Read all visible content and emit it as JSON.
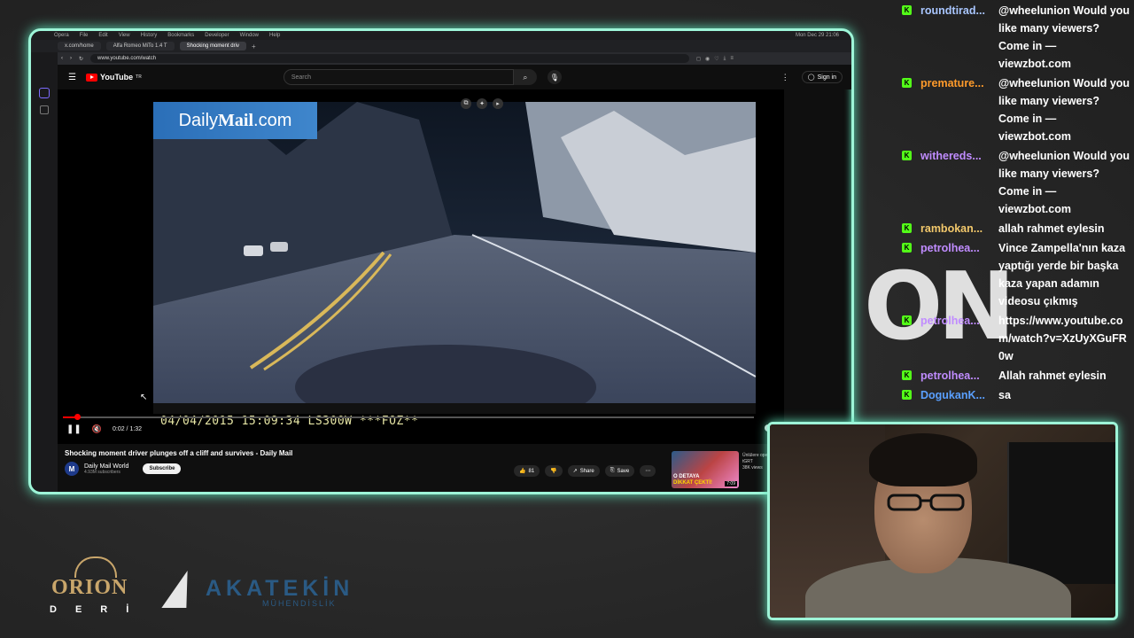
{
  "browser": {
    "mac_menu": [
      "Opera",
      "File",
      "Edit",
      "View",
      "History",
      "Bookmarks",
      "Developer",
      "Window",
      "Help"
    ],
    "clock": "Mon Dec 29  21:06",
    "tabs": [
      {
        "label": "x.com/home"
      },
      {
        "label": "Alfa Romeo MiTo 1.4 T"
      },
      {
        "label": "Shocking moment driv"
      }
    ],
    "url": "www.youtube.com/watch"
  },
  "youtube": {
    "logo_text": "YouTube",
    "logo_sup": "TR",
    "search_placeholder": "Search",
    "signin": "Sign in",
    "watermark_daily": "Daily",
    "watermark_mail": "Mail",
    "watermark_com": ".com",
    "dashcam_overlay": "04/04/2015 15:09:34 LS300W  ***FOZ**",
    "time": "0:02 / 1:32",
    "progress_fraction": 0.02,
    "title": "Shocking moment driver plunges off a cliff and survives - Daily Mail",
    "channel": "Daily Mail World",
    "subscribers": "4.93M subscribers",
    "subscribe": "Subscribe",
    "likes": "81",
    "share": "Share",
    "save": "Save",
    "rec_thumb_line1": "O DETAYA",
    "rec_thumb_line2": "DİKKAT ÇEKTİ!",
    "rec_thumb_time": "7:09",
    "rec_title": "Ünlülere operasyo...",
    "rec_channel": "tGRT",
    "rec_views": "38K views"
  },
  "chat": [
    {
      "user": "roundtirad...",
      "color": "#a9c6ff",
      "text": "@wheelunion Would you like many viewers? Come in — viewzbot.com"
    },
    {
      "user": "premature...",
      "color": "#ff9b2b",
      "text": "@wheelunion Would you like many viewers? Come in — viewzbot.com"
    },
    {
      "user": "withereds...",
      "color": "#c08cff",
      "text": "@wheelunion Would you like many viewers? Come in — viewzbot.com"
    },
    {
      "user": "rambokan...",
      "color": "#f2c86b",
      "text": "allah rahmet eylesin"
    },
    {
      "user": "petrolhea...",
      "color": "#c08cff",
      "text": "Vince Zampella'nın kaza yaptığı yerde bir başka kaza yapan adamın videosu çıkmış"
    },
    {
      "user": "petrolhea...",
      "color": "#c08cff",
      "text": "https://www.youtube.com/watch?v=XzUyXGuFR0w"
    },
    {
      "user": "petrolhea...",
      "color": "#c08cff",
      "text": "Allah rahmet eylesin"
    },
    {
      "user": "DogukanK...",
      "color": "#5aa0ff",
      "text": "sa"
    }
  ],
  "overlay_text": "ON",
  "sponsors": {
    "orion_name": "ORION",
    "orion_sub": "DERİ",
    "akatekin_name": "AKATEKİN",
    "akatekin_sub": "MÜHENDİSLİK"
  },
  "colors": {
    "frame_glow": "#9ef5d8",
    "kick_green": "#53fc18",
    "yt_red": "#ff0000"
  }
}
